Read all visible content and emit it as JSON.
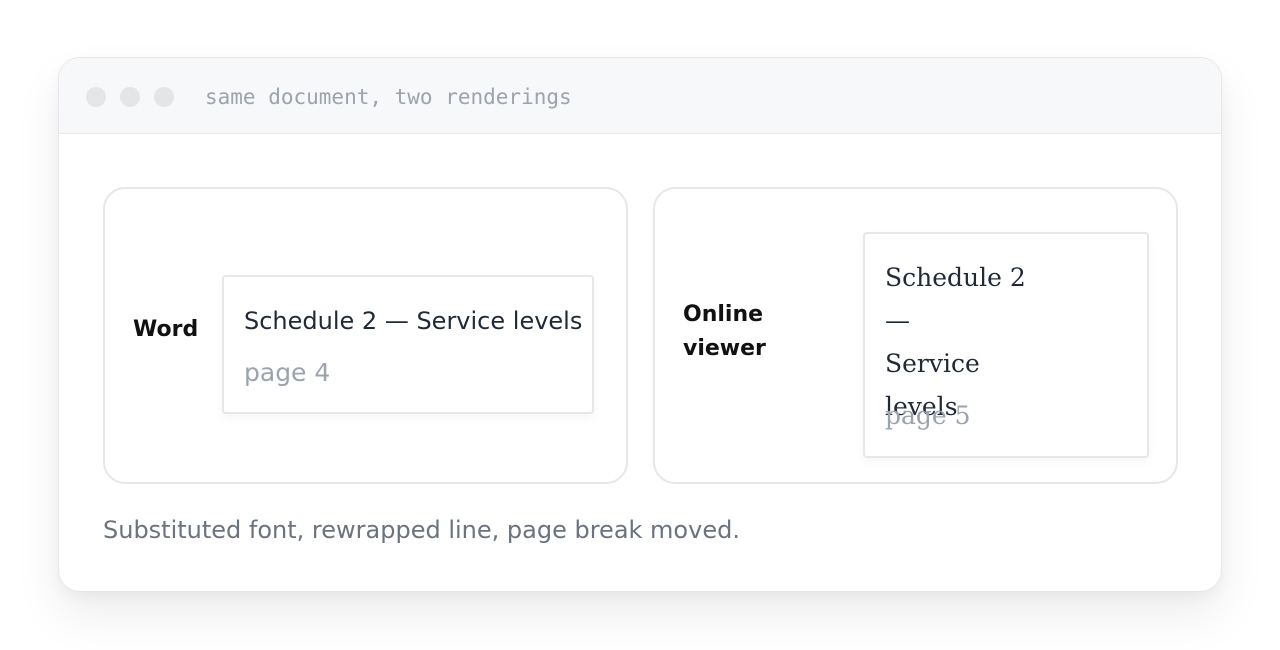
{
  "window": {
    "title": "same document, two renderings"
  },
  "panels": [
    {
      "label": "Word",
      "card": {
        "heading": "Schedule 2 — Service levels",
        "page": "page 4"
      }
    },
    {
      "label": "Online viewer",
      "card": {
        "heading_lines": [
          "Schedule 2 —",
          "Service",
          "levels"
        ],
        "page": "page 5"
      }
    }
  ],
  "caption": "Substituted font, rewrapped line, page break moved.",
  "colors": {
    "border": "#e5e7eb",
    "titlebar_bg": "#f7f8f9",
    "muted_text": "#9ca3af",
    "caption_text": "#6b7280",
    "label_text": "#111111"
  },
  "icons": [
    "window-dot-icon",
    "window-dot-icon",
    "window-dot-icon"
  ]
}
